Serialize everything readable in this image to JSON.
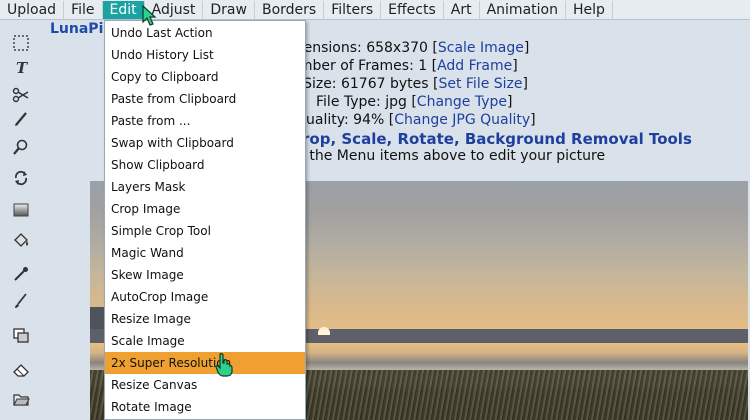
{
  "menubar": {
    "items": [
      "Upload",
      "File",
      "Edit",
      "Adjust",
      "Draw",
      "Borders",
      "Filters",
      "Effects",
      "Art",
      "Animation",
      "Help"
    ],
    "active_index": 2
  },
  "brand": "LunaPic",
  "info": {
    "dimensions_prefix": "mensions: 658x370",
    "dimensions_link": "Scale Image",
    "frames_prefix": "umber of Frames: 1",
    "frames_link": "Add Frame",
    "filesize_prefix": "e Size: 61767 bytes",
    "filesize_link": "Set File Size",
    "filetype_prefix": "File Type: jpg",
    "filetype_link": "Change Type",
    "quality_prefix": "Quality: 94%",
    "quality_link": "Change JPG Quality",
    "tools_crop": "rop",
    "tools_scale": "Scale",
    "tools_rotate": "Rotate",
    "tools_bg": "Background Removal Tools",
    "hint": "f the Menu items above to edit your picture"
  },
  "dropdown": {
    "items": [
      "Undo Last Action",
      "Undo History List",
      "Copy to Clipboard",
      "Paste from Clipboard",
      "Paste from ...",
      "Swap with Clipboard",
      "Show Clipboard",
      "Layers Mask",
      "Crop Image",
      "Simple Crop Tool",
      "Magic Wand",
      "Skew Image",
      "AutoCrop Image",
      "Resize Image",
      "Scale Image",
      "2x Super Resolution",
      "Resize Canvas",
      "Rotate Image"
    ],
    "highlighted_index": 15
  },
  "colors": {
    "menu_active": "#1aa3a3",
    "highlight": "#f0a030",
    "link": "#1f3f9f"
  }
}
